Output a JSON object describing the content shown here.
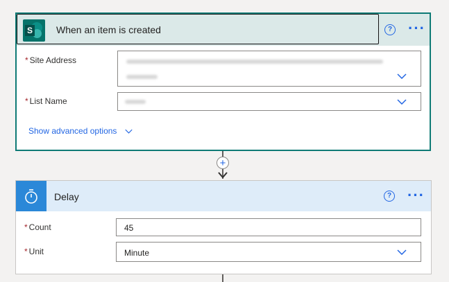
{
  "trigger": {
    "title": "When an item is created",
    "fields": {
      "site_address_label": "Site Address",
      "list_name_label": "List Name",
      "required_mark": "*"
    },
    "advanced_label": "Show advanced options"
  },
  "connector": {
    "plus_label": "+"
  },
  "delay": {
    "title": "Delay",
    "count_label": "Count",
    "count_value": "45",
    "unit_label": "Unit",
    "unit_value": "Minute",
    "required_mark": "*"
  },
  "icons": {
    "help": "?",
    "more": "···"
  },
  "colors": {
    "accent_blue": "#2266e3",
    "trigger_border": "#0e7a75",
    "trigger_header": "#dbe9e8",
    "delay_header": "#deecf9",
    "delay_icon_bg": "#2b88d8",
    "required": "#a4262c"
  }
}
